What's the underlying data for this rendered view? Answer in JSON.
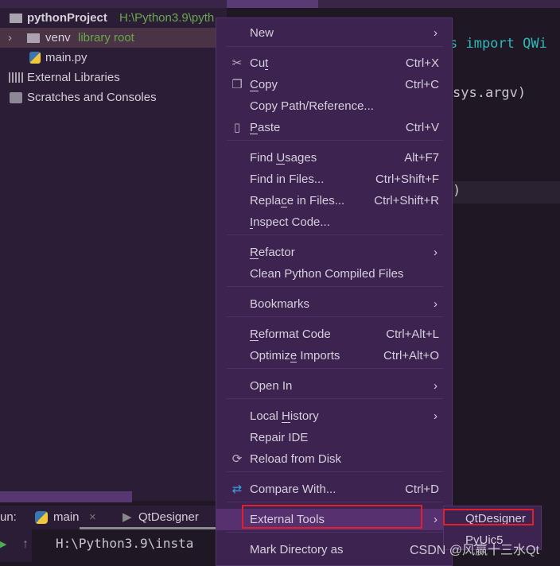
{
  "project_tree": {
    "project": {
      "name": "pythonProject",
      "path": "H:\\Python3.9\\pyth"
    },
    "venv": {
      "name": "venv",
      "tag": "library root"
    },
    "file": "main.py",
    "external": "External Libraries",
    "scratches": "Scratches and Consoles"
  },
  "editor": {
    "line1": "s import QWi",
    "line2": "sys.argv)",
    "line3": ")"
  },
  "context_menu": {
    "items": [
      {
        "label": "New",
        "submenu": true
      },
      {
        "label": "Cut",
        "shortcut": "Ctrl+X",
        "icon": "scissors-icon"
      },
      {
        "label": "Copy",
        "shortcut": "Ctrl+C",
        "icon": "copy-icon"
      },
      {
        "label": "Copy Path/Reference..."
      },
      {
        "label": "Paste",
        "shortcut": "Ctrl+V",
        "icon": "clipboard-icon"
      },
      {
        "label": "Find Usages",
        "shortcut": "Alt+F7"
      },
      {
        "label": "Find in Files...",
        "shortcut": "Ctrl+Shift+F"
      },
      {
        "label": "Replace in Files...",
        "shortcut": "Ctrl+Shift+R"
      },
      {
        "label": "Inspect Code..."
      },
      {
        "label": "Refactor",
        "submenu": true
      },
      {
        "label": "Clean Python Compiled Files"
      },
      {
        "label": "Bookmarks",
        "submenu": true
      },
      {
        "label": "Reformat Code",
        "shortcut": "Ctrl+Alt+L"
      },
      {
        "label": "Optimize Imports",
        "shortcut": "Ctrl+Alt+O"
      },
      {
        "label": "Open In",
        "submenu": true
      },
      {
        "label": "Local History",
        "submenu": true
      },
      {
        "label": "Repair IDE"
      },
      {
        "label": "Reload from Disk",
        "icon": "reload-icon"
      },
      {
        "label": "Compare With...",
        "shortcut": "Ctrl+D",
        "icon": "compare-icon"
      },
      {
        "label": "External Tools",
        "submenu": true,
        "highlighted": true
      },
      {
        "label": "Mark Directory as"
      }
    ]
  },
  "submenu": {
    "items": [
      "QtDesigner",
      "PyUic5"
    ]
  },
  "run_panel": {
    "label": "un:",
    "tabs": [
      "main",
      "QtDesigner"
    ],
    "console": "H:\\Python3.9\\insta"
  },
  "watermark": "CSDN @风赢十三水Qt",
  "colors": {
    "menu_bg": "#3d2350",
    "highlight": "#56306f",
    "annotation_red": "#e0202a",
    "library_green": "#6aa84f"
  }
}
